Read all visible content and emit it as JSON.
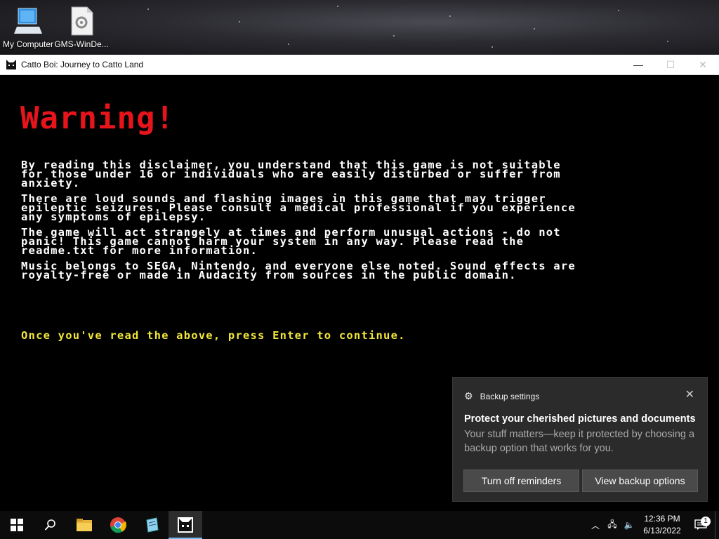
{
  "desktop": {
    "icons": [
      {
        "label": "My Computer",
        "icon": "computer-icon"
      },
      {
        "label": "GMS-WinDe...",
        "icon": "settings-file-icon"
      }
    ]
  },
  "window": {
    "title": "Catto Boi: Journey to Catto Land",
    "minimize": "—",
    "maximize": "☐",
    "close": "✕"
  },
  "game": {
    "heading": "Warning!",
    "paragraphs": [
      "By reading this disclaimer, you understand that this game is not suitable\nfor those under 16 or individuals who are easily disturbed or suffer from\nanxiety.",
      "There are loud sounds and flashing images in this game that may trigger\nepileptic seizures. Please consult a medical professional if you experience\nany symptoms of epilepsy.",
      "The game will act strangely at times and perform unusual actions - do not\npanic! This game cannot harm your system in any way. Please read the\nreadme.txt for more information.",
      "Music belongs to SEGA, Nintendo, and everyone else noted. Sound effects are\nroyalty-free or made in Audacity from sources in the public domain."
    ],
    "prompt": "Once you've read the above, press Enter to continue.",
    "colors": {
      "heading": "#e8141c",
      "body": "#ffffff",
      "prompt": "#f2e63a"
    }
  },
  "toast": {
    "app": "Backup settings",
    "close": "✕",
    "title": "Protect your cherished pictures and documents",
    "body": "Your stuff matters—keep it protected by choosing a backup option that works for you.",
    "buttons": [
      "Turn off reminders",
      "View backup options"
    ]
  },
  "taskbar": {
    "items": [
      "start-icon",
      "search-icon",
      "file-explorer-icon",
      "chrome-icon",
      "notepad-icon",
      "catto-game-icon"
    ],
    "time": "12:36 PM",
    "date": "6/13/2022",
    "notification_count": "1"
  }
}
